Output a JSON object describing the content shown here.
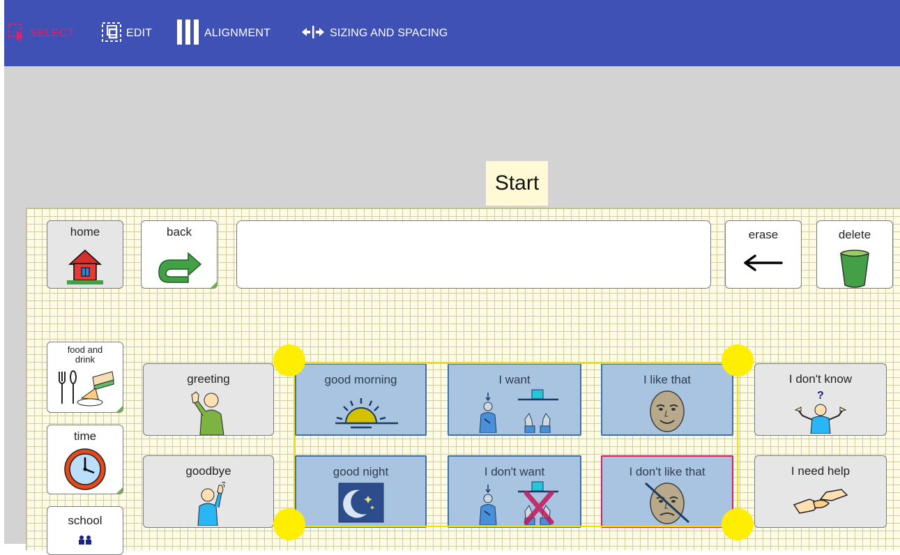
{
  "toolbar": {
    "select_label": "SELECT",
    "edit_label": "EDIT",
    "alignment_label": "ALIGNMENT",
    "sizing_label": "SIZING AND SPACING",
    "active_mode": "select"
  },
  "page_title": "Start",
  "colors": {
    "toolbar_bg": "#3f51b5",
    "active_accent": "#e91e63",
    "canvas_bg": "#d3d3d3",
    "board_bg": "#fdfbe4",
    "selected_cell_bg": "#a9c4e1",
    "selection_outline": "#f2e000",
    "handle": "#ffee00"
  },
  "top_row": {
    "home": {
      "label": "home",
      "icon": "house-icon"
    },
    "back": {
      "label": "back",
      "icon": "back-arrow-icon"
    },
    "erase": {
      "label": "erase",
      "icon": "left-arrow-icon"
    },
    "delete": {
      "label": "delete",
      "icon": "trash-cup-icon"
    }
  },
  "left_column": [
    {
      "label": "food and drink",
      "icon": "food-icon"
    },
    {
      "label": "time",
      "icon": "clock-icon"
    },
    {
      "label": "school",
      "icon": "school-people-icon"
    }
  ],
  "category_cells": [
    {
      "label": "greeting",
      "icon": "waving-person-icon"
    },
    {
      "label": "goodbye",
      "icon": "waving-goodbye-icon"
    }
  ],
  "selected_cells": [
    {
      "label": "good morning",
      "icon": "sunrise-icon"
    },
    {
      "label": "I want",
      "icon": "want-sign-icon"
    },
    {
      "label": "I like that",
      "icon": "smiling-face-icon"
    },
    {
      "label": "good night",
      "icon": "moon-stars-icon"
    },
    {
      "label": "I don't want",
      "icon": "dont-want-sign-icon"
    },
    {
      "label": "I don't like that",
      "icon": "crossed-face-icon"
    }
  ],
  "right_cells": [
    {
      "label": "I don't know",
      "icon": "shrugging-person-icon"
    },
    {
      "label": "I need help",
      "icon": "helping-hands-icon"
    }
  ]
}
